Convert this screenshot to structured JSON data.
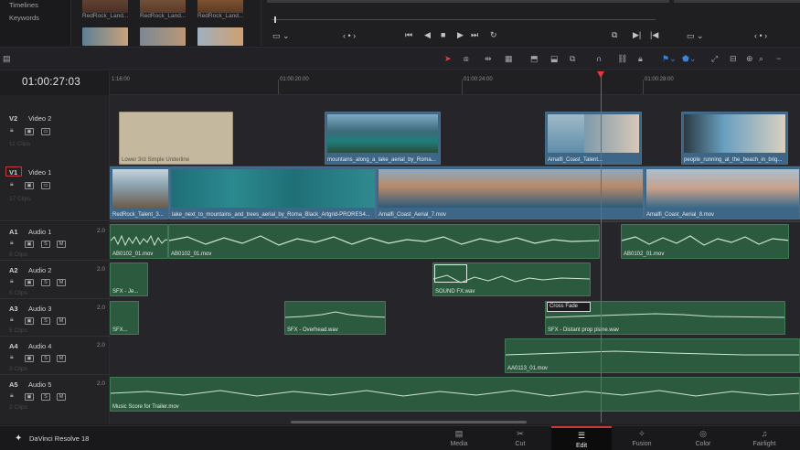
{
  "left_nav": {
    "items": [
      "Timelines",
      "Keywords"
    ]
  },
  "media_thumbs": [
    {
      "label": "RedRock_Land...",
      "color": "#6b4a3a"
    },
    {
      "label": "RedRock_Land...",
      "color": "#7a5a3e"
    },
    {
      "label": "RedRock_Land...",
      "color": "#8a5c3a"
    }
  ],
  "timecode": "01:00:27:03",
  "ruler_labels": [
    {
      "text": "1:16:00"
    },
    {
      "text": "01:00:20:00"
    },
    {
      "text": "01:00:24:00"
    },
    {
      "text": "01:00:28:00"
    }
  ],
  "tracks": {
    "v2": {
      "id": "V2",
      "name": "Video 2",
      "clips": "11 Clips"
    },
    "v1": {
      "id": "V1",
      "name": "Video 1",
      "clips": "17 Clips"
    },
    "a1": {
      "id": "A1",
      "name": "Audio 1",
      "clips": "8 Clips",
      "vol": "2.0"
    },
    "a2": {
      "id": "A2",
      "name": "Audio 2",
      "clips": "5 Clips",
      "vol": "2.0"
    },
    "a3": {
      "id": "A3",
      "name": "Audio 3",
      "clips": "5 Clips",
      "vol": "2.0"
    },
    "a4": {
      "id": "A4",
      "name": "Audio 4",
      "clips": "3 Clips",
      "vol": "2.0"
    },
    "a5": {
      "id": "A5",
      "name": "Audio 5",
      "clips": "2 Clips",
      "vol": "2.0"
    }
  },
  "clips": {
    "v2_title": "Lower 3rd Simple Underline",
    "v2_mountains": "mountains_along_a_lake_aerial_by_Roma...",
    "v2_amalfi": "Amalfi_Coast_Talent...",
    "v2_people": "people_running_at_the_beach_in_brig...",
    "v1_redrock": "RedRock_Talent_3...",
    "v1_lake": "lake_next_to_mountains_and_trees_aerial_by_Roma_Black_Artgrid-PRORES4...",
    "v1_amalfi7": "Amalfi_Coast_Aerial_7.mov",
    "v1_amalfi8": "Amalfi_Coast_Aerial_8.mov",
    "a1_left": "AB0102_01.mov",
    "a1_mid": "AB0102_01.mov",
    "a1_right": "AB0102_01.mov",
    "a2_left": "SFX - Je...",
    "a2_sound": "SOUND FX.wav",
    "a3_left": "SFX...",
    "a3_overhead": "SFX - Overhead.wav",
    "a3_crossfade": "Cross Fade",
    "a3_prop": "SFX - Distant prop plane.wav",
    "a4_clip": "AA0113_01.mov",
    "a5_music": "Music Score for Trailer.mov"
  },
  "button_labels": {
    "solo": "S",
    "mute": "M"
  },
  "app_name": "DaVinci Resolve 18",
  "pages": [
    "Media",
    "Cut",
    "Edit",
    "Fusion",
    "Color",
    "Fairlight"
  ],
  "active_page": "Edit",
  "colors": {
    "playhead": "#e03a3a",
    "video_clip": "#3d6687",
    "audio_clip": "#2c5a3e",
    "accent": "#c9363b"
  }
}
